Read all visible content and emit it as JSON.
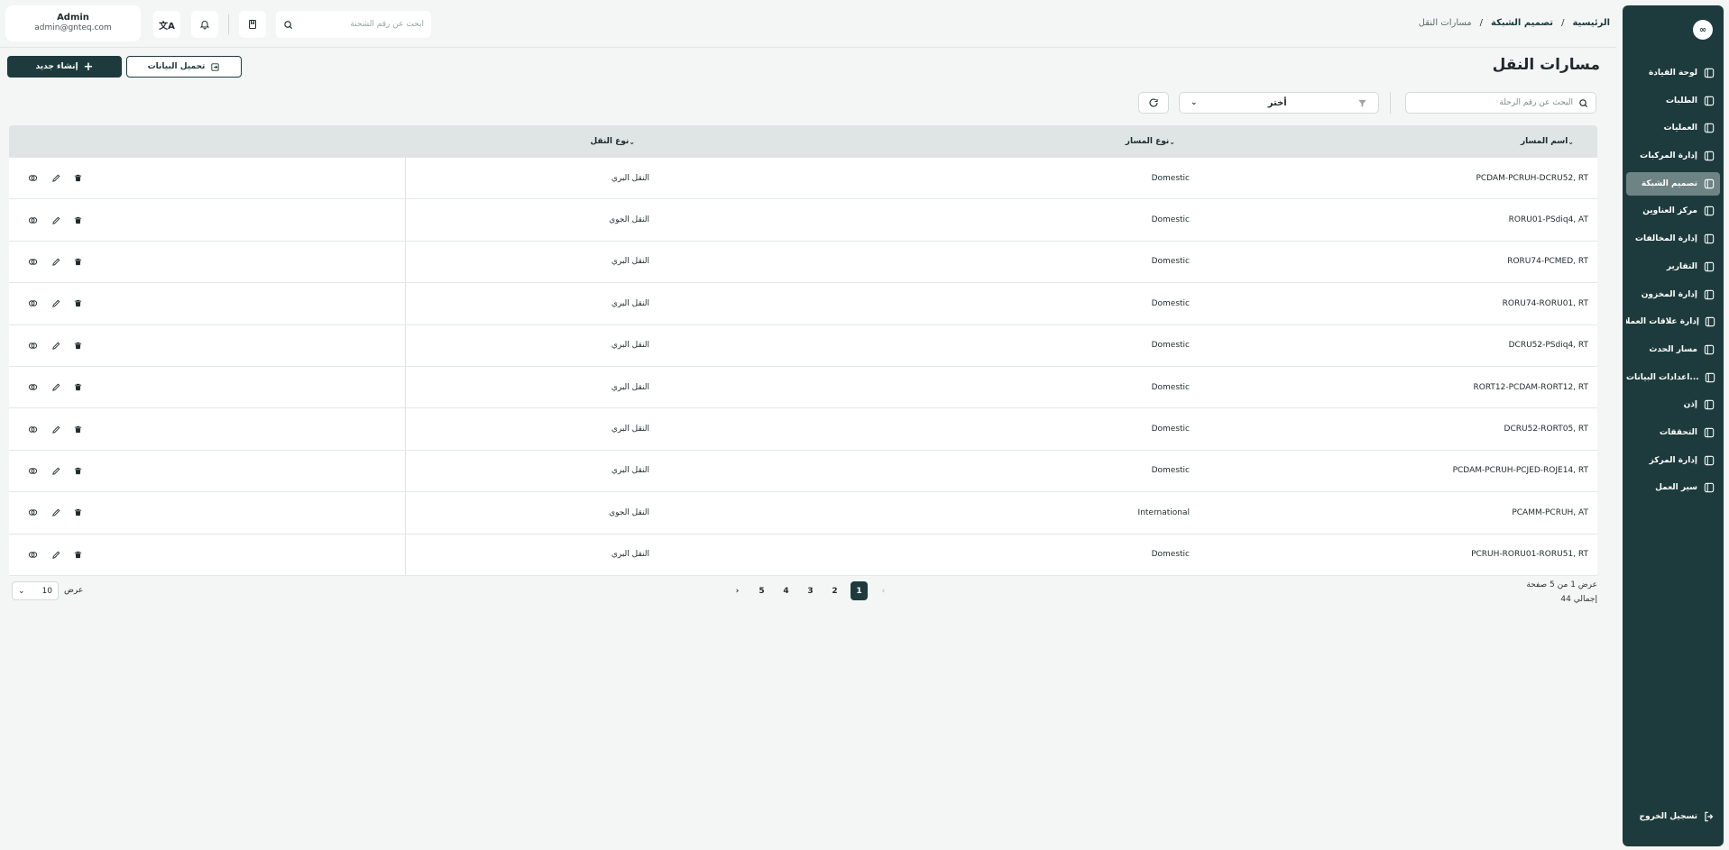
{
  "sidebar": {
    "logo": "∞",
    "items": [
      {
        "label": "لوحة القيادة",
        "icon": "dashboard-icon"
      },
      {
        "label": "الطلبات",
        "icon": "orders-icon"
      },
      {
        "label": "العمليات",
        "icon": "operations-icon"
      },
      {
        "label": "إدارة المركبات",
        "icon": "truck-icon"
      },
      {
        "label": "تصميم الشبكة",
        "icon": "network-icon"
      },
      {
        "label": "مركز العناوين",
        "icon": "location-icon"
      },
      {
        "label": "إدارة المخالفات",
        "icon": "violations-icon"
      },
      {
        "label": "التقارير",
        "icon": "reports-icon"
      },
      {
        "label": "إدارة المخزون",
        "icon": "inventory-icon"
      },
      {
        "label": "إدارة علاقات العملاء",
        "icon": "crm-icon"
      },
      {
        "label": "مسار الحدث",
        "icon": "route-icon"
      },
      {
        "label": "اعدادات البيانات...",
        "icon": "database-icon"
      },
      {
        "label": "إذن",
        "icon": "users-icon"
      },
      {
        "label": "التحققات",
        "icon": "tools-icon"
      },
      {
        "label": "إدارة المركز",
        "icon": "center-icon"
      },
      {
        "label": "سير العمل",
        "icon": "workflow-icon"
      }
    ],
    "active_index": 4,
    "logout_label": "تسجيل الخروج"
  },
  "header": {
    "user_name": "Admin",
    "user_email": "admin@gnteq.com",
    "search_placeholder": "ابحث عن رقم الشحنة",
    "breadcrumb": [
      "الرئيسية",
      "تصميم الشبكة",
      "مسارات النقل"
    ]
  },
  "main": {
    "title": "مسارات النقل",
    "create_label": "إنشاء جديد",
    "download_label": "تحميل البيانات",
    "trip_search_placeholder": "البحث عن رقم الرحلة",
    "filter_label": "أختر"
  },
  "table": {
    "columns": [
      "اسم المسار",
      "نوع المسار",
      "نوع النقل"
    ],
    "rows": [
      {
        "name": "PCDAM-PCRUH-DCRU52, RT",
        "type": "Domestic",
        "mode": "النقل البري"
      },
      {
        "name": "RORU01-PSdiq4, AT",
        "type": "Domestic",
        "mode": "النقل الجوي"
      },
      {
        "name": "RORU74-PCMED, RT",
        "type": "Domestic",
        "mode": "النقل البري"
      },
      {
        "name": "RORU74-RORU01, RT",
        "type": "Domestic",
        "mode": "النقل البري"
      },
      {
        "name": "DCRU52-PSdiq4, RT",
        "type": "Domestic",
        "mode": "النقل البري"
      },
      {
        "name": "RORT12-PCDAM-RORT12, RT",
        "type": "Domestic",
        "mode": "النقل البري"
      },
      {
        "name": "DCRU52-RORT05, RT",
        "type": "Domestic",
        "mode": "النقل البري"
      },
      {
        "name": "PCDAM-PCRUH-PCJED-ROJE14, RT",
        "type": "Domestic",
        "mode": "النقل البري"
      },
      {
        "name": "PCAMM-PCRUH, AT",
        "type": "International",
        "mode": "النقل الجوي"
      },
      {
        "name": "PCRUH-RORU01-RORU51, RT",
        "type": "Domestic",
        "mode": "النقل البري"
      }
    ]
  },
  "pagination": {
    "info": "عرض 1 من 5 صفحة",
    "total": "إجمالي 44",
    "pages": [
      "1",
      "2",
      "3",
      "4",
      "5"
    ],
    "current": "1",
    "page_size_label": "عرض",
    "page_size": "10"
  },
  "colors": {
    "brand": "#1d3b3c",
    "active_nav": "#6d8384"
  }
}
